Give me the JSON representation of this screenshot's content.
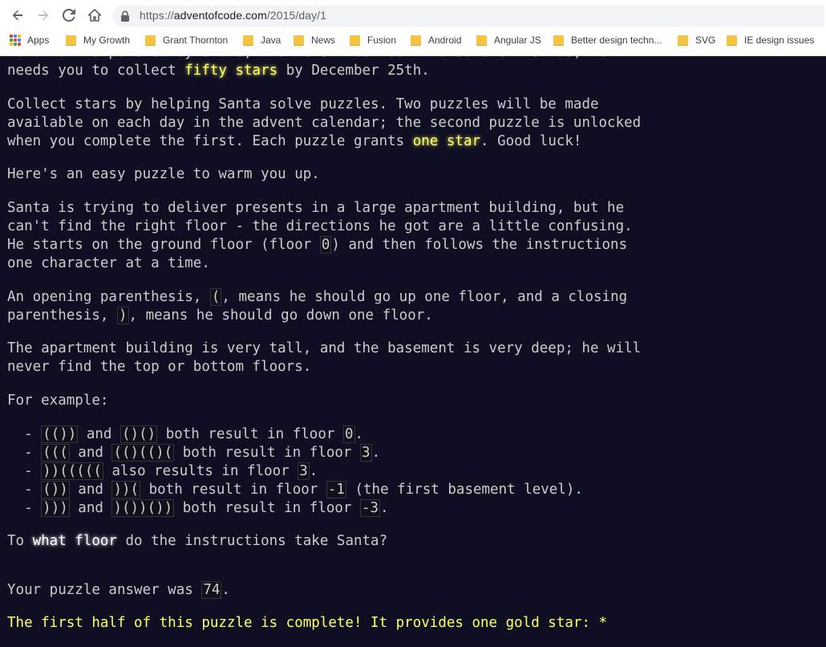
{
  "browser": {
    "url_scheme": "https://",
    "url_host": "adventofcode.com",
    "url_path": "/2015/day/1",
    "bookmarks": [
      {
        "label": "Apps",
        "icon": "apps-grid-icon"
      },
      {
        "label": "My Growth",
        "icon": "folder-icon"
      },
      {
        "label": "Grant Thornton",
        "icon": "folder-icon"
      },
      {
        "label": "Java",
        "icon": "folder-icon"
      },
      {
        "label": "News",
        "icon": "folder-icon"
      },
      {
        "label": "Fusion",
        "icon": "folder-icon"
      },
      {
        "label": "Android",
        "icon": "folder-icon"
      },
      {
        "label": "Angular JS",
        "icon": "folder-icon"
      },
      {
        "label": "Better design techn...",
        "icon": "folder-icon"
      },
      {
        "label": "SVG",
        "icon": "folder-icon"
      },
      {
        "label": "IE design issues",
        "icon": "folder-icon"
      }
    ]
  },
  "article": {
    "p0_cut": "function is powered by stars, and he's fresh out! To save Christmas, he",
    "p0_a": "needs you to collect ",
    "p0_em": "fifty stars",
    "p0_b": " by December 25th.",
    "p1_l1": "Collect stars by helping Santa solve puzzles. Two puzzles will be made",
    "p1_l2": "available on each day in the advent calendar; the second puzzle is unlocked",
    "p1_l3a": "when you complete the first. Each puzzle grants ",
    "p1_l3em": "one star",
    "p1_l3b": ". Good luck!",
    "p2": "Here's an easy puzzle to warm you up.",
    "p3_l1": "Santa is trying to deliver presents in a large apartment building, but he",
    "p3_l2": "can't find the right floor - the directions he got are a little confusing.",
    "p3_l3a": "He starts on the ground floor (floor ",
    "p3_l3code": "0",
    "p3_l3b": ") and then follows the instructions",
    "p3_l4": "one character at a time.",
    "p4_l1a": "An opening parenthesis, ",
    "p4_l1code": "(",
    "p4_l1b": ", means he should go up one floor, and a closing",
    "p4_l2a": "parenthesis, ",
    "p4_l2code": ")",
    "p4_l2b": ", means he should go down one floor.",
    "p5_l1": "The apartment building is very tall, and the basement is very deep; he will",
    "p5_l2": "never find the top or bottom floors.",
    "p6": "For example:",
    "examples": [
      {
        "c1": "(())",
        "mid": " and ",
        "c2": "()()",
        "tail": " both result in floor ",
        "res": "0",
        "end": "."
      },
      {
        "c1": "(((",
        "mid": " and ",
        "c2": "(()(()(",
        "tail": " both result in floor ",
        "res": "3",
        "end": "."
      },
      {
        "c1": "))(((((",
        "mid": "",
        "c2": "",
        "tail": " also results in floor ",
        "res": "3",
        "end": "."
      },
      {
        "c1": "())",
        "mid": " and ",
        "c2": "))(",
        "tail": " both result in floor ",
        "res": "-1",
        "end": " (the first basement level)."
      },
      {
        "c1": ")))",
        "mid": " and ",
        "c2": ")())())",
        "tail": " both result in floor ",
        "res": "-3",
        "end": "."
      }
    ],
    "question_a": "To ",
    "question_em": "what floor",
    "question_b": " do the instructions take Santa?",
    "answer_a": "Your puzzle answer was ",
    "answer_val": "74",
    "answer_b": ".",
    "complete_text": "The first half of this puzzle is complete! It provides one gold star: *"
  }
}
